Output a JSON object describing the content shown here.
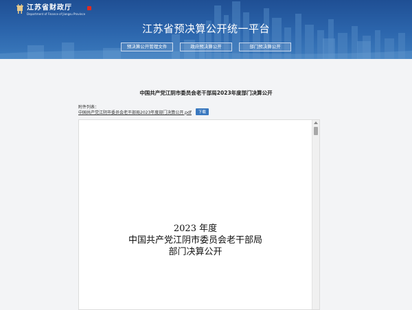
{
  "header": {
    "logo_cn": "江苏省财政厅",
    "logo_en": "Department of Finance of Jiangsu Province",
    "title": "江苏省预决算公开统一平台"
  },
  "nav": {
    "items": [
      {
        "label": "预决算公开管理文件"
      },
      {
        "label": "政府预决算公开"
      },
      {
        "label": "部门预决算公开"
      }
    ]
  },
  "content": {
    "title": "中国共产党江阴市委员会老干部局2023年度部门决算公开",
    "attachment_label": "附件列表：",
    "attachment_file": "中国共产党江阴市委员会老干部局2023年度部门决算公开.pdf",
    "download_label": "下载"
  },
  "pdf": {
    "line1": "2023 年度",
    "line2": "中国共产党江阴市委员会老干部局",
    "line3": "部门决算公开"
  },
  "colors": {
    "header_top": "#1f4f94",
    "header_bottom": "#3c7bbd",
    "download_button": "#3a78bf",
    "seal_red": "#e02b20"
  }
}
